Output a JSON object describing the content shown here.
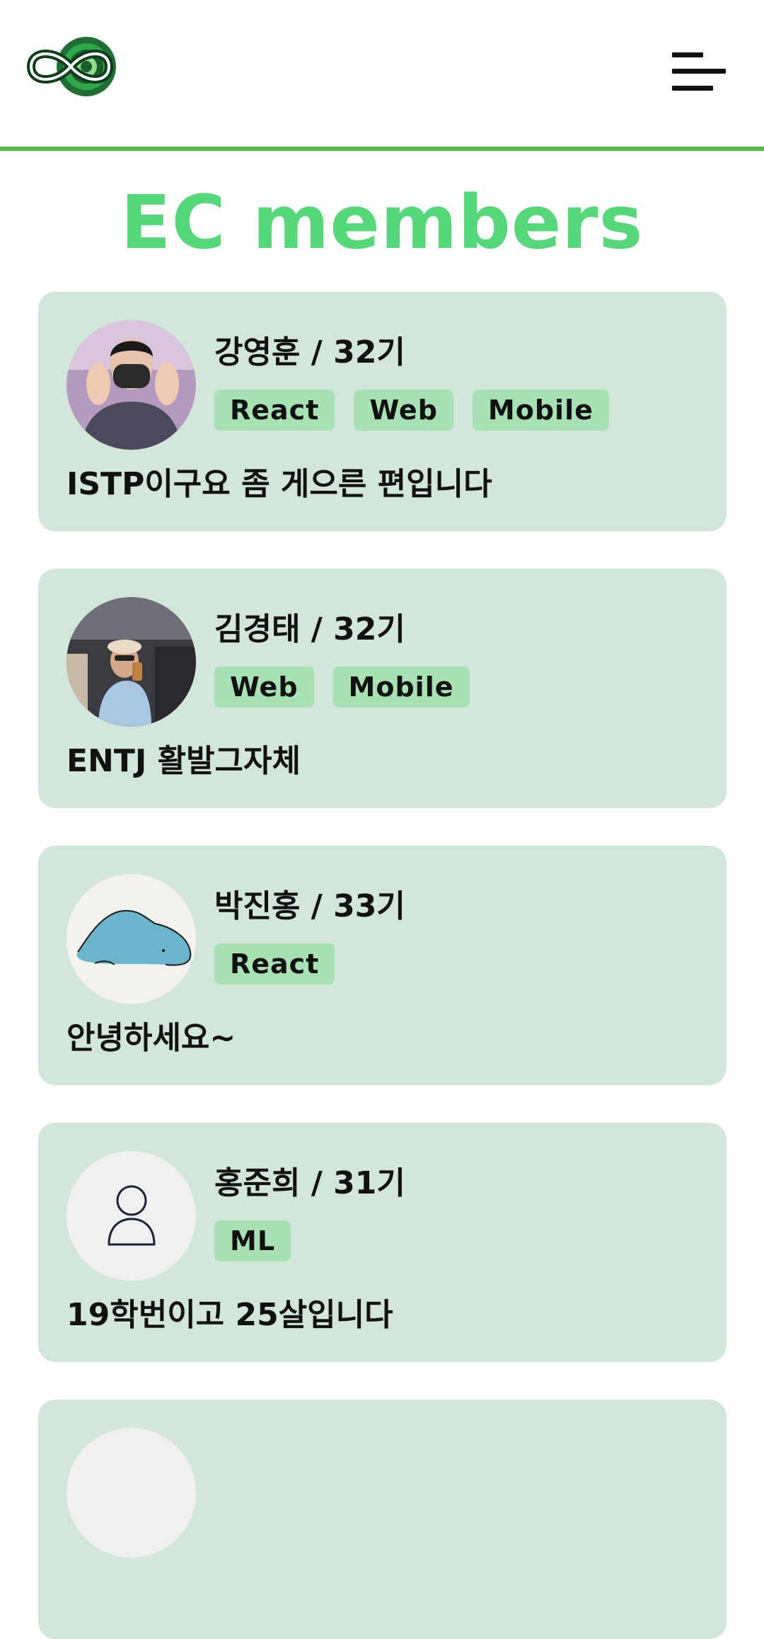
{
  "header": {
    "logo_icon": "infinity-logo-icon",
    "menu_icon": "hamburger-menu-icon",
    "accent_color": "#4fbe3f"
  },
  "page": {
    "title": "EC members",
    "title_color": "#55d879"
  },
  "members": [
    {
      "name": "강영훈 / 32기",
      "tags": [
        "React",
        "Web",
        "Mobile"
      ],
      "bio": "ISTP이구요 좀 게으른 편입니다",
      "avatar": "photo-person-masked"
    },
    {
      "name": "김경태 / 32기",
      "tags": [
        "Web",
        "Mobile"
      ],
      "bio": "ENTJ 활발그자체",
      "avatar": "photo-person-store"
    },
    {
      "name": "박진홍 / 33기",
      "tags": [
        "React"
      ],
      "bio": "안녕하세요~",
      "avatar": "blue-blob-drawing"
    },
    {
      "name": "홍준희 / 31기",
      "tags": [
        "ML"
      ],
      "bio": "19학번이고 25살입니다",
      "avatar": "default-user-icon"
    }
  ]
}
